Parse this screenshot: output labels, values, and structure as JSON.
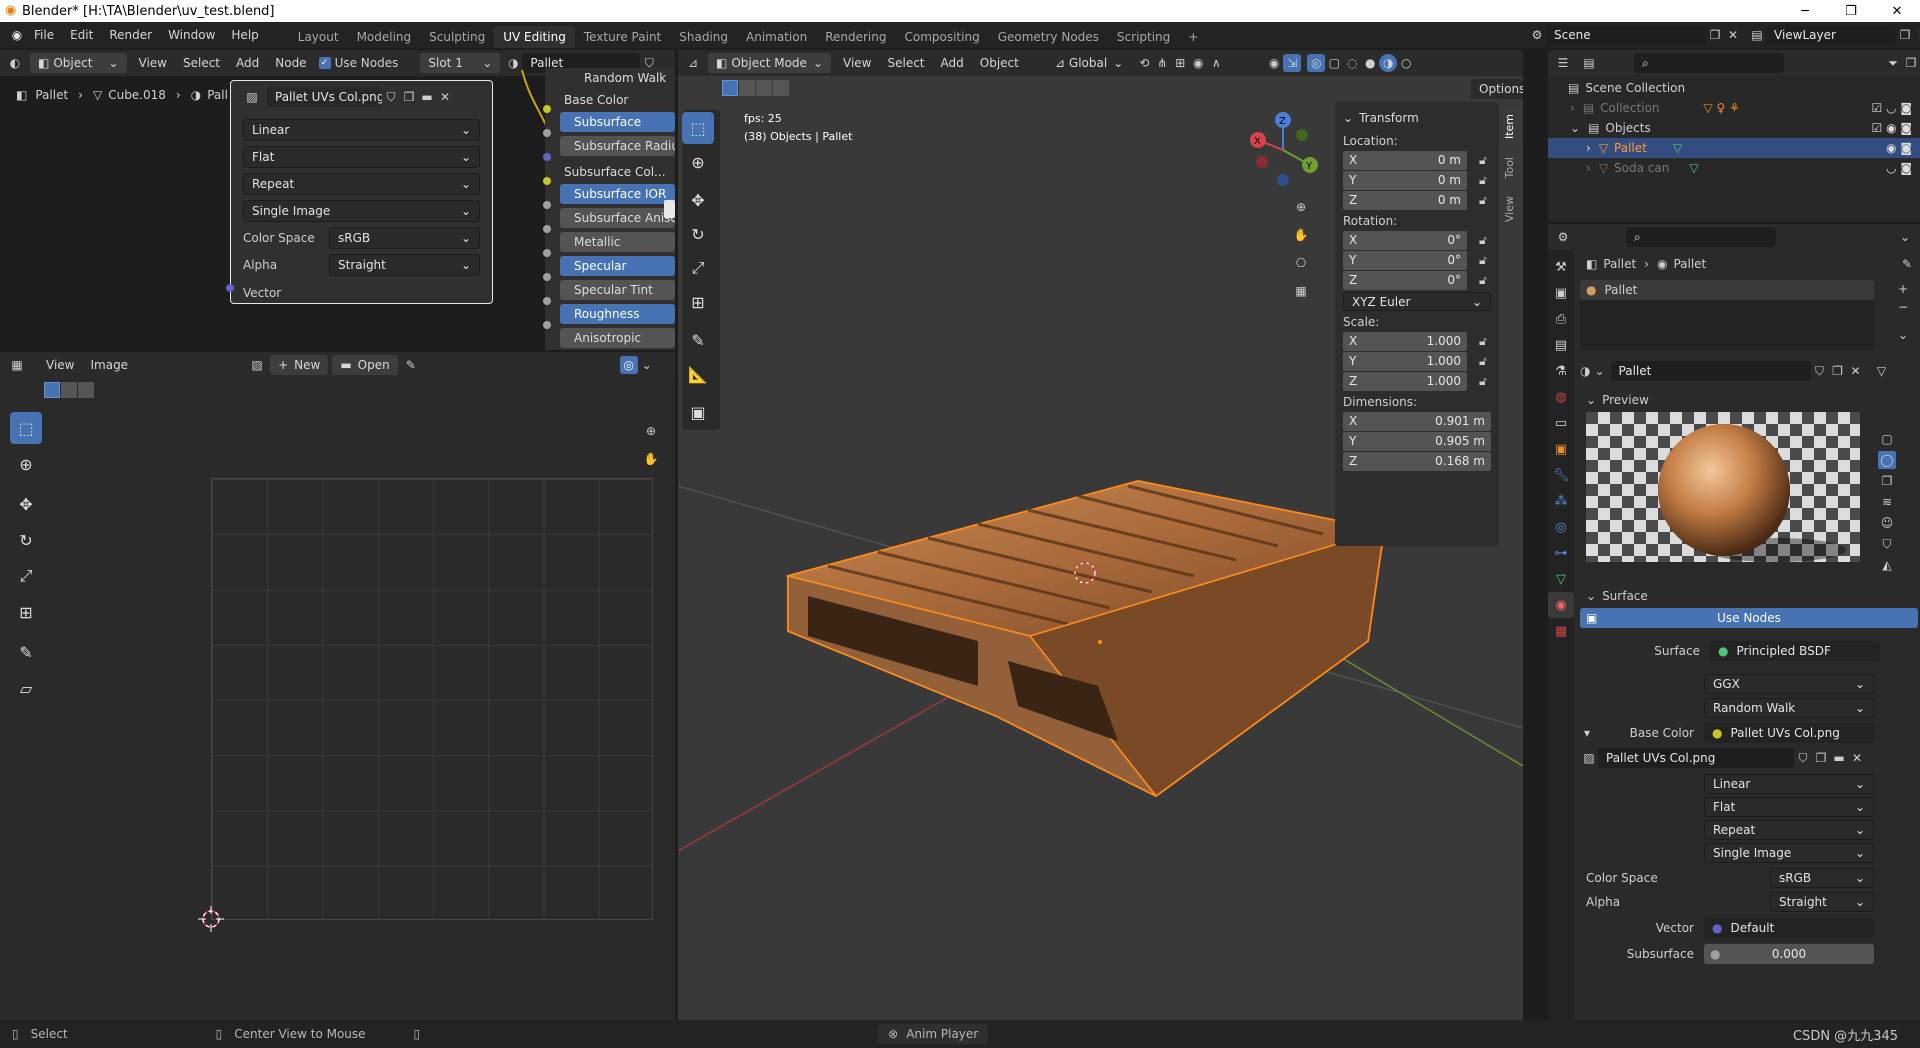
{
  "window": {
    "title": "Blender* [H:\\TA\\Blender\\uv_test.blend]",
    "minimize": "─",
    "maximize": "❐",
    "close": "✕"
  },
  "menu": [
    "File",
    "Edit",
    "Render",
    "Window",
    "Help"
  ],
  "workspaces": [
    "Layout",
    "Modeling",
    "Sculpting",
    "UV Editing",
    "Texture Paint",
    "Shading",
    "Animation",
    "Rendering",
    "Compositing",
    "Geometry Nodes",
    "Scripting",
    "+"
  ],
  "scene": {
    "label": "Scene",
    "view_layer": "ViewLayer"
  },
  "node_editor": {
    "mode": "Object",
    "menus": [
      "View",
      "Select",
      "Add",
      "Node"
    ],
    "use_nodes": "Use Nodes",
    "slot": "Slot 1",
    "material": "Pallet",
    "breadcrumb": [
      "Pallet",
      "Cube.018",
      "Pall"
    ],
    "image_name": "Pallet UVs Col.png",
    "interp": "Linear",
    "projection": "Flat",
    "extension": "Repeat",
    "source": "Single Image",
    "color_space_label": "Color Space",
    "color_space": "sRGB",
    "alpha_label": "Alpha",
    "alpha": "Straight",
    "vector": "Vector",
    "bsdf_items": [
      "Random Walk",
      "Base Color",
      "Subsurface",
      "Subsurface Radius",
      "Subsurface Col...",
      "Subsurface IOR",
      "Subsurface Anisot",
      "Metallic",
      "Specular",
      "Specular Tint",
      "Roughness",
      "Anisotropic"
    ]
  },
  "image_editor": {
    "menus": [
      "View",
      "Image"
    ],
    "new": "New",
    "open": "Open"
  },
  "viewport": {
    "mode": "Object Mode",
    "menus": [
      "View",
      "Select",
      "Add",
      "Object"
    ],
    "orientation": "Global",
    "options": "Options",
    "fps": "fps: 25",
    "info": "(38) Objects | Pallet",
    "tabs": [
      "Item",
      "Tool",
      "View"
    ]
  },
  "transform": {
    "title": "Transform",
    "location_label": "Location:",
    "location": {
      "X": "0 m",
      "Y": "0 m",
      "Z": "0 m"
    },
    "rotation_label": "Rotation:",
    "rotation": {
      "X": "0°",
      "Y": "0°",
      "Z": "0°"
    },
    "rotation_mode": "XYZ Euler",
    "scale_label": "Scale:",
    "scale": {
      "X": "1.000",
      "Y": "1.000",
      "Z": "1.000"
    },
    "dimensions_label": "Dimensions:",
    "dimensions": {
      "X": "0.901 m",
      "Y": "0.905 m",
      "Z": "0.168 m"
    }
  },
  "outliner": {
    "scene_collection": "Scene Collection",
    "collection": "Collection",
    "objects": "Objects",
    "pallet": "Pallet",
    "soda": "Soda can"
  },
  "properties": {
    "breadcrumb": [
      "Pallet",
      "Pallet"
    ],
    "slot_material": "Pallet",
    "material_name": "Pallet",
    "preview": "Preview",
    "surface_section": "Surface",
    "use_nodes": "Use Nodes",
    "surface_label": "Surface",
    "surface_value": "Principled BSDF",
    "distribution": "GGX",
    "subsurface_method": "Random Walk",
    "base_color_label": "Base Color",
    "base_color_value": "Pallet UVs Col.png",
    "image_name": "Pallet UVs Col.png",
    "interp": "Linear",
    "projection": "Flat",
    "extension": "Repeat",
    "source": "Single Image",
    "color_space_label": "Color Space",
    "color_space": "sRGB",
    "alpha_label": "Alpha",
    "alpha": "Straight",
    "vector_label": "Vector",
    "vector_value": "Default",
    "subsurface_label": "Subsurface",
    "subsurface_value": "0.000"
  },
  "status": {
    "select": "Select",
    "center": "Center View to Mouse",
    "anim": "Anim Player",
    "watermark": "CSDN @九九345"
  },
  "colors": {
    "accent": "#4772b3",
    "selection": "#ff8c1a",
    "bg": "#1d1d1d"
  }
}
